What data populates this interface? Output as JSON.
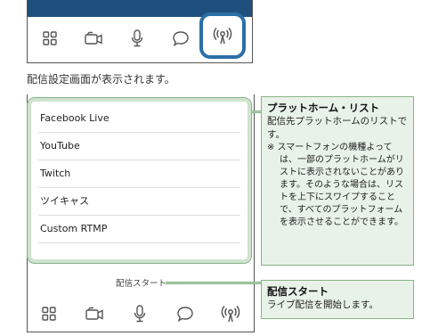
{
  "caption": "配信設定画面が表示されます。",
  "platform_list": {
    "items": [
      "Facebook Live",
      "YouTube",
      "Twitch",
      "ツイキャス",
      "Custom RTMP"
    ]
  },
  "start_button_label": "配信スタート",
  "callout_platform": {
    "title": "プラットホーム・リスト",
    "body": "配信先プラットホームのリストです。",
    "note": "※ スマートフォンの機種よっては、一部のプラットホームがリストに表示されないことがあります。そのような場合は、リストを上下にスワイプすることで、すべてのプラットフォームを表示させることができます。"
  },
  "callout_start": {
    "title": "配信スタート",
    "body": "ライブ配信を開始します。"
  },
  "tabs": [
    "grid-icon",
    "camera-icon",
    "microphone-icon",
    "chat-icon",
    "broadcast-icon"
  ],
  "colors": {
    "header_blue": "#1f4f7d",
    "highlight_blue": "#2b6fa8",
    "callout_green": "#e8f2e8",
    "accent_green": "#86b486"
  }
}
